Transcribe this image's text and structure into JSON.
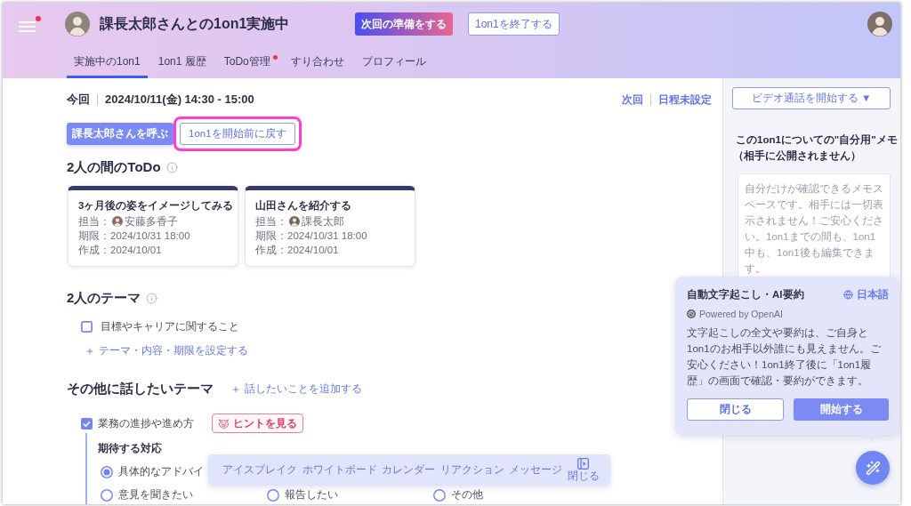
{
  "header": {
    "menu_badge": true,
    "title": "課長太郎さんとの1on1実施中",
    "buttons": [
      {
        "label": "次回の準備をする",
        "kind": "gradient"
      },
      {
        "label": "1on1を終了する",
        "kind": "outline"
      }
    ]
  },
  "tabs": [
    {
      "label": "実施中の1on1",
      "selected": true,
      "badge": false
    },
    {
      "label": "1on1 履歴",
      "selected": false,
      "badge": false
    },
    {
      "label": "ToDo管理",
      "selected": false,
      "badge": true
    },
    {
      "label": "すり合わせ",
      "selected": false,
      "badge": false
    },
    {
      "label": "プロフィール",
      "selected": false,
      "badge": false
    }
  ],
  "session": {
    "label": "今回",
    "datetime": "2024/10/11(金) 14:30 - 15:00",
    "next_label": "次回",
    "next_value": "日程未設定"
  },
  "actions": [
    {
      "label": "課長太郎さんを呼ぶ",
      "kind": "primary",
      "highlighted": false
    },
    {
      "label": "1on1を開始前に戻す",
      "kind": "outline",
      "highlighted": true
    }
  ],
  "todo": {
    "title": "2人の間のToDo",
    "cards": [
      {
        "title": "3ヶ月後の姿をイメージしてみる",
        "assignee_label": "担当：",
        "assignee": "安藤多香子",
        "due": "期限：2024/10/31 18:00",
        "created": "作成：2024/10/01"
      },
      {
        "title": "山田さんを紹介する",
        "assignee_label": "担当：",
        "assignee": "課長太郎",
        "due": "期限：2024/10/31 18:00",
        "created": "作成：2024/10/01"
      }
    ]
  },
  "themes": {
    "title": "2人のテーマ",
    "items": [
      {
        "label": "目標やキャリアに関すること",
        "checked": false
      }
    ],
    "add_link": "テーマ・内容・期限を設定する"
  },
  "other_themes": {
    "title": "その他に話したいテーマ",
    "add_link": "話したいことを追加する",
    "items": [
      {
        "label": "業務の進捗や進め方",
        "checked": true,
        "hint_button": "ヒントを見る",
        "response": {
          "title": "期待する対応",
          "options": [
            {
              "label": "具体的なアドバイ",
              "selected": true
            },
            {
              "label": "意見を聞きたい",
              "selected": false
            },
            {
              "label": "報告したい",
              "selected": false
            },
            {
              "label": "その他",
              "selected": false
            }
          ]
        }
      }
    ]
  },
  "toolbar": {
    "items": [
      "アイスブレイク",
      "ホワイトボード",
      "カレンダー",
      "リアクション",
      "メッセージ"
    ],
    "close_label": "閉じる"
  },
  "sidebar": {
    "video_button": "ビデオ通話を開始する ▼",
    "memo": {
      "title": "この1on1についての\"自分用\"メモ",
      "note": "（相手に公開されません）",
      "placeholder": "自分だけが確認できるメモスペースです。相手には一切表示されません！ご安心ください。1on1までの間も、1on1中も、1on1後も編集できます。"
    }
  },
  "popover": {
    "title": "自動文字起こし・AI要約",
    "language": "日本語",
    "powered_by": "Powered by OpenAI",
    "body": "文字起こしの全文や要約は、ご自身と1on1のお相手以外誰にも見えません。ご安心ください！1on1終了後に「1on1履歴」の画面で確認・要約ができます。",
    "buttons": [
      {
        "label": "閉じる",
        "kind": "outline"
      },
      {
        "label": "開始する",
        "kind": "primary"
      }
    ]
  }
}
